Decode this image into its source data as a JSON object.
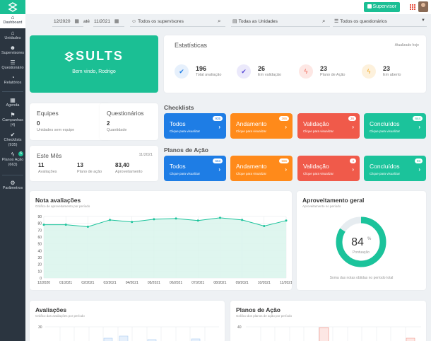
{
  "sidebar": {
    "items": [
      {
        "label": "Dashboard",
        "icon": "dashboard-icon"
      },
      {
        "label": "Unidades",
        "icon": "home-icon"
      },
      {
        "label": "Supervisores",
        "icon": "users-icon"
      },
      {
        "label": "Questionário",
        "icon": "list-icon"
      },
      {
        "label": "Relatórios",
        "icon": "pie-icon"
      },
      {
        "label": "Agenda",
        "icon": "calendar-icon"
      },
      {
        "label": "Campanhas",
        "count": "(4)",
        "icon": "flag-icon"
      },
      {
        "label": "Checklists",
        "count": "(935)",
        "icon": "check-icon"
      },
      {
        "label": "Planos Ação",
        "count": "(663)",
        "icon": "bolt-icon",
        "badge": "6"
      },
      {
        "label": "Parâmetros",
        "icon": "gears-icon"
      }
    ]
  },
  "topbar": {
    "supervisor_label": "Supervisor"
  },
  "filters": {
    "date_from": "12/2020",
    "date_sep": "até",
    "date_to": "11/2021",
    "supervisors": "Todos os supervisores",
    "units": "Todas as Unidades",
    "questionnaires": "Todos os questionários"
  },
  "brand": {
    "name": "SULTS",
    "welcome": "Bem vindo, Rodrigo"
  },
  "stats": {
    "title": "Estatísticas",
    "updated": "Atualizado hoje",
    "items": [
      {
        "value": "196",
        "label": "Total avaliação",
        "icon": "check-icon",
        "color": "#1e7de5",
        "bg": "#e6f0fc"
      },
      {
        "value": "26",
        "label": "Em validação",
        "icon": "check-icon",
        "color": "#5b4bd6",
        "bg": "#ebe9fb"
      },
      {
        "value": "23",
        "label": "Plano de Ação",
        "icon": "bolt-icon",
        "color": "#f05a4a",
        "bg": "#fde7e4"
      },
      {
        "value": "23",
        "label": "Em aberto",
        "icon": "bolt-icon",
        "color": "#f0a21a",
        "bg": "#fdf1dc"
      }
    ]
  },
  "equipes": {
    "title": "Equipes",
    "value": "0",
    "sub": "Unidades sem equipe"
  },
  "questionarios": {
    "title": "Questionários",
    "value": "2",
    "sub": "Quantidade"
  },
  "mes": {
    "title": "Este Mês",
    "date": "11/2021",
    "items": [
      {
        "value": "11",
        "label": "Avaliações"
      },
      {
        "value": "13",
        "label": "Plano de ação"
      },
      {
        "value": "83,40",
        "label": "Aproveitamento"
      }
    ]
  },
  "checklists": {
    "title": "Checklists",
    "tiles": [
      {
        "label": "Todos",
        "sub": "Clique para visualizar",
        "count": "935",
        "color": "blue"
      },
      {
        "label": "Andamento",
        "sub": "Clique para visualizar",
        "count": "265",
        "color": "orange"
      },
      {
        "label": "Validação",
        "sub": "Clique para visualizar",
        "count": "26",
        "color": "red"
      },
      {
        "label": "Concluídos",
        "sub": "Clique para visualizar",
        "count": "644",
        "color": "teal"
      }
    ]
  },
  "planos": {
    "title": "Planos de Ação",
    "tiles": [
      {
        "label": "Todos",
        "sub": "Clique para visualizar",
        "count": "663",
        "color": "blue"
      },
      {
        "label": "Andamento",
        "sub": "Clique para visualizar",
        "count": "566",
        "color": "orange"
      },
      {
        "label": "Validação",
        "sub": "Clique para visualizar",
        "count": "4",
        "color": "red"
      },
      {
        "label": "Concluídos",
        "sub": "Clique para visualizar",
        "count": "93",
        "color": "teal"
      }
    ]
  },
  "nota": {
    "title": "Nota avaliações",
    "subtitle": "Gráfico de aproveitamento por período"
  },
  "aproveitamento": {
    "title": "Aproveitamento geral",
    "subtitle": "Aproveitamento no período",
    "value": "84",
    "unit": "%",
    "label": "Pontuação",
    "caption": "Soma das notas obtidas no período total"
  },
  "avaliacoes": {
    "title": "Avaliações",
    "subtitle": "Gráfico das avaliações por período"
  },
  "planos_chart": {
    "title": "Planos de Ação",
    "subtitle": "Gráfico dos planos de ação por período"
  },
  "chart_data": [
    {
      "type": "area",
      "title": "Nota avaliações",
      "categories": [
        "12/2020",
        "01/2021",
        "02/2021",
        "03/2021",
        "04/2021",
        "05/2021",
        "06/2021",
        "07/2021",
        "08/2021",
        "09/2021",
        "10/2021",
        "11/2021"
      ],
      "values": [
        78,
        78,
        75,
        85,
        82,
        86,
        87,
        84,
        88,
        85,
        76,
        84
      ],
      "yticks": [
        0,
        10,
        20,
        30,
        40,
        50,
        60,
        70,
        80,
        90
      ],
      "ylim": [
        0,
        90
      ],
      "color": "#1bc39b"
    },
    {
      "type": "pie",
      "title": "Aproveitamento geral",
      "values": [
        84,
        16
      ],
      "color": "#1bc39b"
    }
  ]
}
